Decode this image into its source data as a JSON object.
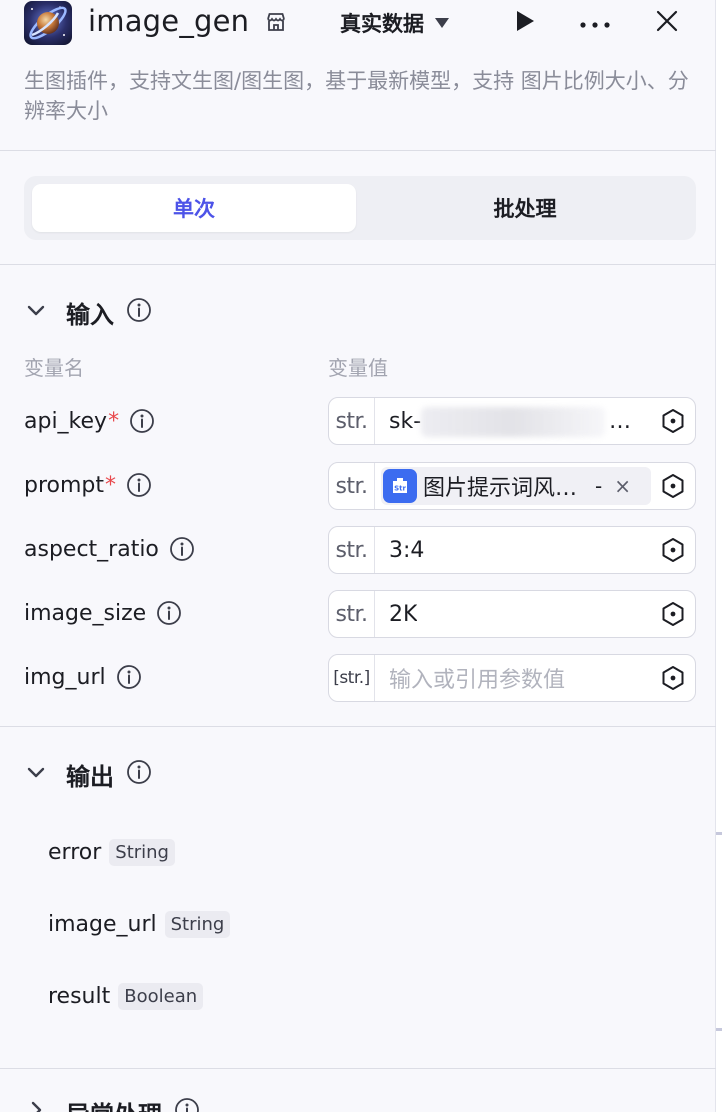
{
  "header": {
    "title": "image_gen",
    "data_source": "真实数据",
    "run_label": "▶",
    "more_label": "···",
    "close_label": "✕"
  },
  "description": "生图插件，支持文生图/图生图，基于最新模型，支持 图片比例大小、分辨率大小",
  "tabs": [
    {
      "label": "单次",
      "active": true
    },
    {
      "label": "批处理",
      "active": false
    }
  ],
  "input_section": {
    "title": "输入",
    "col_name": "变量名",
    "col_value": "变量值",
    "params": [
      {
        "name": "api_key",
        "required": true,
        "type": "str.",
        "value": "sk-",
        "value_tail": "…"
      },
      {
        "name": "prompt",
        "required": true,
        "type": "str.",
        "ref_label": "图片提示词风…",
        "ref_icon": "Str",
        "ref_dash": "-",
        "ref_close": "×"
      },
      {
        "name": "aspect_ratio",
        "required": false,
        "type": "str.",
        "value": "3:4"
      },
      {
        "name": "image_size",
        "required": false,
        "type": "str.",
        "value": "2K"
      },
      {
        "name": "img_url",
        "required": false,
        "type": "[str.]",
        "placeholder": "输入或引用参数值"
      }
    ]
  },
  "output_section": {
    "title": "输出",
    "outputs": [
      {
        "name": "error",
        "type": "String"
      },
      {
        "name": "image_url",
        "type": "String"
      },
      {
        "name": "result",
        "type": "Boolean"
      }
    ]
  },
  "exception_section": {
    "title": "异常处理"
  },
  "colors": {
    "accent": "#4d53e8",
    "required": "#e8484c",
    "background": "#f8f8fc",
    "ref_icon": "#3c6cf0"
  },
  "icons": [
    "app-logo",
    "store-icon",
    "caret-down-icon",
    "play-icon",
    "more-icon",
    "close-icon",
    "chevron-down-icon",
    "info-icon",
    "variable-ref-icon",
    "str-icon"
  ]
}
